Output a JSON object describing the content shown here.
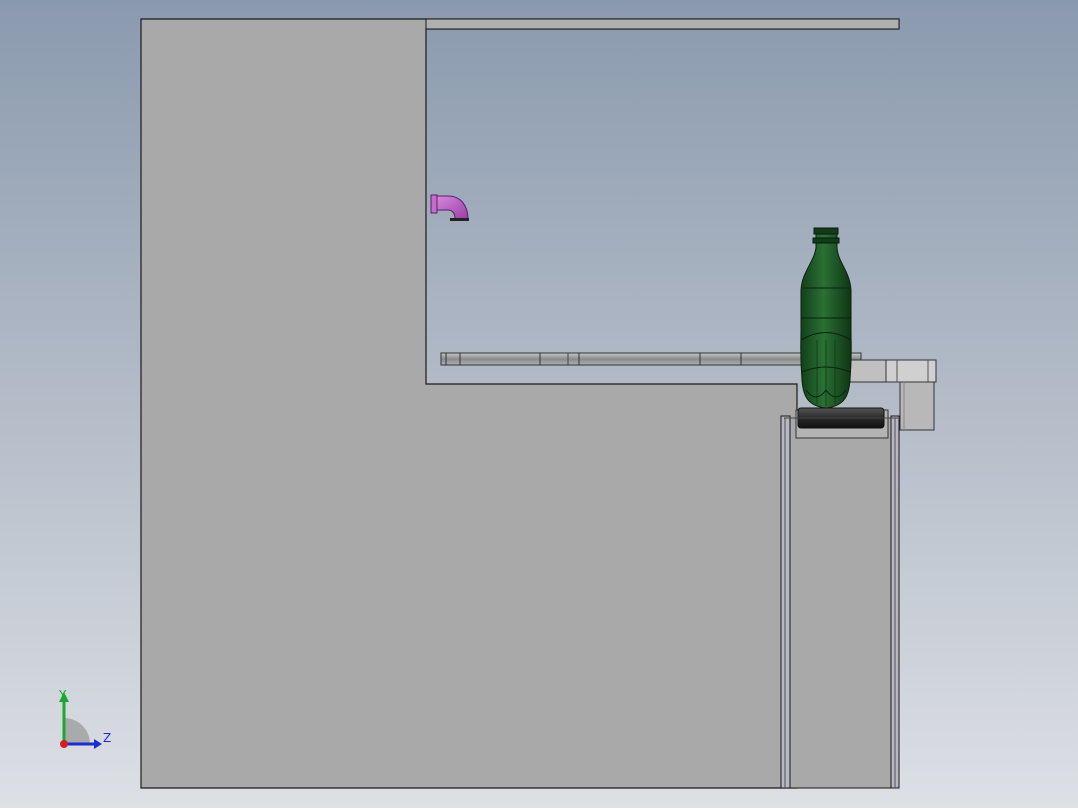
{
  "viewport": {
    "background_top": "#8b9cb0",
    "background_bottom": "#d8dce2",
    "model": {
      "enclosure_color": "#a8a8a8",
      "edge_color": "#222222",
      "bottle_color": "#1e5a28",
      "pipe_elbow_color": "#b85cc0",
      "roller_color": "#2c2c2c"
    }
  },
  "triad": {
    "y_label": "Y",
    "z_label": "Z",
    "y_color": "#1aa830",
    "z_color": "#1a2ed0",
    "origin_color": "#d02020"
  }
}
